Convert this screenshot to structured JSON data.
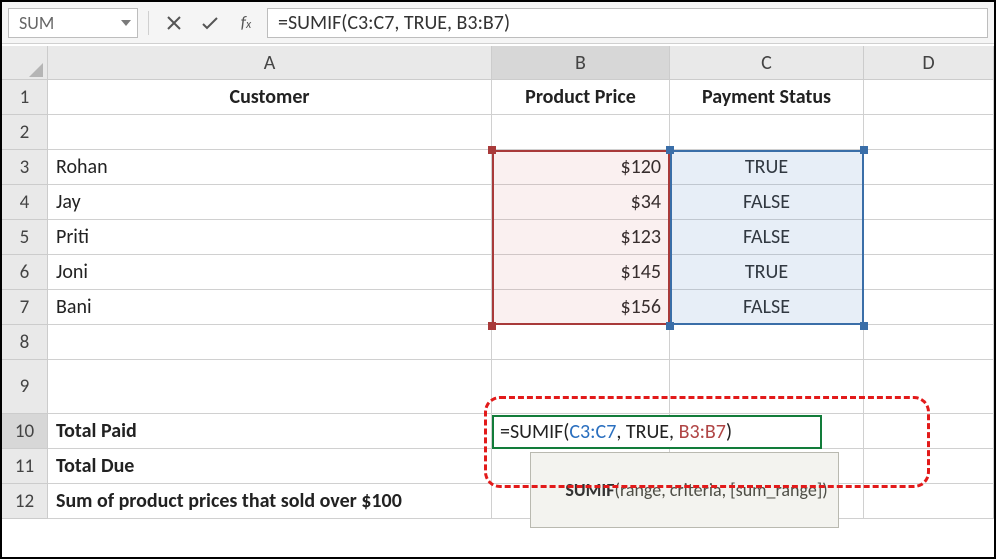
{
  "namebox": "SUM",
  "formula_bar": "=SUMIF(C3:C7, TRUE, B3:B7)",
  "columns": [
    "A",
    "B",
    "C",
    "D"
  ],
  "row_numbers": [
    1,
    2,
    3,
    4,
    5,
    6,
    7,
    8,
    9,
    10,
    11,
    12
  ],
  "headers": {
    "A": "Customer",
    "B": "Product Price",
    "C": "Payment Status"
  },
  "data_rows": [
    {
      "A": "Rohan",
      "B": "$120",
      "C": "TRUE"
    },
    {
      "A": "Jay",
      "B": "$34",
      "C": "FALSE"
    },
    {
      "A": "Priti",
      "B": "$123",
      "C": "FALSE"
    },
    {
      "A": "Joni",
      "B": "$145",
      "C": "TRUE"
    },
    {
      "A": "Bani",
      "B": "$156",
      "C": "FALSE"
    }
  ],
  "labels": {
    "r10": "Total Paid",
    "r11": "Total Due",
    "r12": "Sum of product prices that sold over $100"
  },
  "edit_formula": {
    "pre": "=SUMIF(",
    "arg1": "C3:C7",
    "mid": ", TRUE, ",
    "arg2": "B3:B7",
    "post": ")"
  },
  "tooltip": {
    "fn": "SUMIF",
    "sig": "(range, criteria, [sum_range])"
  },
  "chart_data": {
    "type": "table",
    "title": "SUMIF example worksheet",
    "columns": [
      "Customer",
      "Product Price",
      "Payment Status"
    ],
    "rows": [
      [
        "Rohan",
        120,
        true
      ],
      [
        "Jay",
        34,
        false
      ],
      [
        "Priti",
        123,
        false
      ],
      [
        "Joni",
        145,
        true
      ],
      [
        "Bani",
        156,
        false
      ]
    ],
    "formula_cell": "B10",
    "formula": "=SUMIF(C3:C7, TRUE, B3:B7)"
  }
}
